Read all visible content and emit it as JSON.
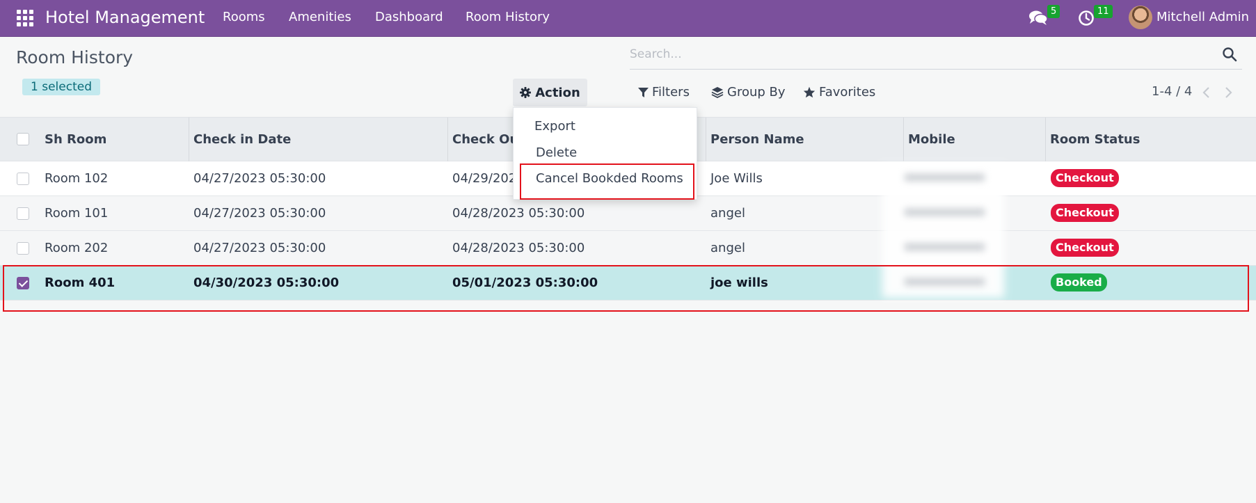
{
  "navbar": {
    "brand": "Hotel Management",
    "menu": [
      "Rooms",
      "Amenities",
      "Dashboard",
      "Room History"
    ],
    "messages_count": "5",
    "activities_count": "11",
    "user_name": "Mitchell Admin",
    "color": "#7b509c"
  },
  "control": {
    "title": "Room History",
    "selected_label": "1 selected",
    "action_label": "Action",
    "search_placeholder": "Search...",
    "filters_label": "Filters",
    "groupby_label": "Group By",
    "favorites_label": "Favorites",
    "pager": "1-4 / 4"
  },
  "action_menu": {
    "items": [
      "Export",
      "Delete",
      "Cancel Bookded Rooms"
    ]
  },
  "table": {
    "columns": [
      "Sh Room",
      "Check in Date",
      "Check Ou",
      "Person Name",
      "Mobile",
      "Room Status"
    ],
    "rows": [
      {
        "room": "Room 102",
        "check_in": "04/27/2023 05:30:00",
        "check_out": "04/29/202",
        "person": "Joe Wills",
        "status": "Checkout",
        "selected": false
      },
      {
        "room": "Room 101",
        "check_in": "04/27/2023 05:30:00",
        "check_out": "04/28/2023 05:30:00",
        "person": "angel",
        "status": "Checkout",
        "selected": false
      },
      {
        "room": "Room 202",
        "check_in": "04/27/2023 05:30:00",
        "check_out": "04/28/2023 05:30:00",
        "person": "angel",
        "status": "Checkout",
        "selected": false
      },
      {
        "room": "Room 401",
        "check_in": "04/30/2023 05:30:00",
        "check_out": "05/01/2023 05:30:00",
        "person": "joe wills",
        "status": "Booked",
        "selected": true
      }
    ]
  },
  "status_colors": {
    "Checkout": "#e3163f",
    "Booked": "#19ad48"
  },
  "highlight_color": "#e3121b"
}
